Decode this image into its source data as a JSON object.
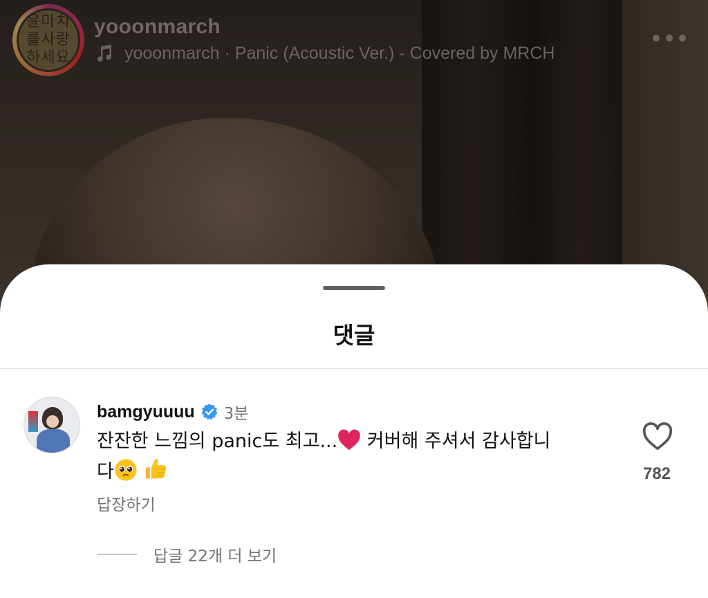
{
  "header": {
    "avatar_text": "윤마치를사랑하세요",
    "username": "yooonmarch",
    "music_label": "yooonmarch · Panic (Acoustic Ver.) - Covered by MRCH"
  },
  "sheet": {
    "title": "댓글"
  },
  "comment": {
    "username": "bamgyuuuu",
    "verified": true,
    "time": "3분",
    "text_line1": "잔잔한 느낌의 panic도 최고...",
    "text_line1_after_heart": " 커버해 주셔서 감사합니",
    "text_line2": "다",
    "like_count": "782",
    "reply_label": "답장하기",
    "view_replies_label": "답글 22개 더 보기"
  },
  "colors": {
    "verified_blue": "#3897f0",
    "heart_red": "#e0245e",
    "muted_text": "#737373"
  },
  "icons": {
    "music": "music-note-icon",
    "more": "more-horizontal-icon",
    "verified": "verified-badge-icon",
    "like": "heart-outline-icon",
    "red_heart": "red-heart-emoji",
    "pleading_face": "pleading-face-emoji",
    "thumbs_up": "thumbs-up-emoji"
  }
}
